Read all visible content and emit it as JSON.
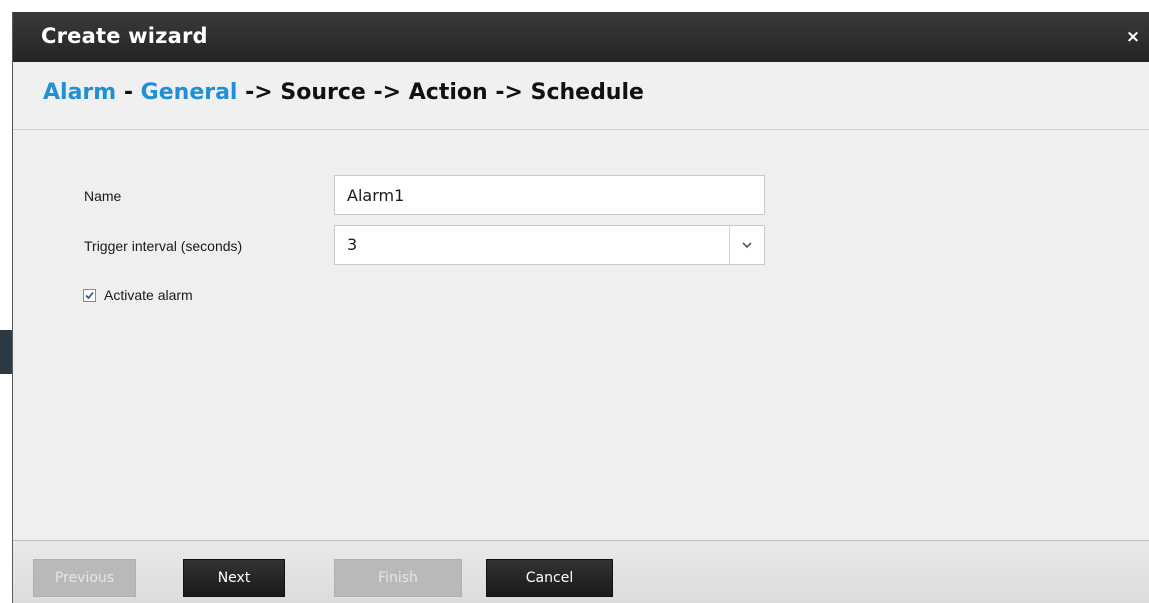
{
  "dialog": {
    "title": "Create wizard",
    "close_glyph": "×"
  },
  "steps": {
    "current_group": "Alarm",
    "dash": "-",
    "current_step": "General",
    "arrow": "->",
    "remaining": [
      "Source",
      "Action",
      "Schedule"
    ],
    "active_color": "#1e90d6"
  },
  "form": {
    "name_label": "Name",
    "name_value": "Alarm1",
    "trigger_label": "Trigger interval (seconds)",
    "trigger_value": "3",
    "activate_label": "Activate alarm",
    "activate_checked": true
  },
  "buttons": {
    "previous": "Previous",
    "next": "Next",
    "finish": "Finish",
    "cancel": "Cancel"
  },
  "icons": {
    "close": "close-icon",
    "dropdown": "chevron-down-icon",
    "check": "checkmark-icon"
  }
}
